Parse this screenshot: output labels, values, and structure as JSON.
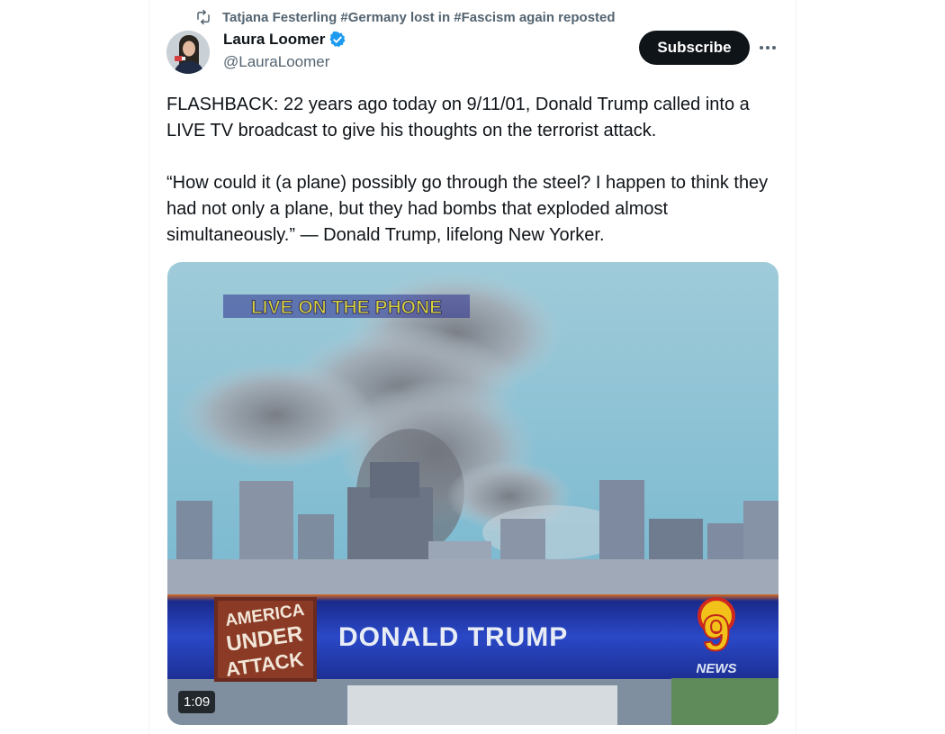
{
  "repost": {
    "icon": "repost-icon",
    "text": "Tatjana Festerling #Germany lost in #Fascism again reposted"
  },
  "author": {
    "name": "Laura Loomer",
    "handle": "@LauraLoomer",
    "verified_icon": "verified-badge-icon",
    "verified_color": "#1d9bf0"
  },
  "subscribe_label": "Subscribe",
  "more_icon": "more-options-icon",
  "tweet_text": "FLASHBACK: 22 years ago today on 9/11/01, Donald Trump called into a LIVE TV broadcast to give his thoughts on the terrorist attack.\n\n“How could it (a plane) possibly go through the steel? I happen to think they had not only a plane, but they had bombs that exploded almost simultaneously.” — Donald Trump, lifelong New Yorker.",
  "video": {
    "overlay_top": "LIVE ON THE PHONE",
    "chyron_name": "DONALD TRUMP",
    "chyron_logo_lines": [
      "AMERICA",
      "UNDER",
      "ATTACK"
    ],
    "station_number": "9",
    "station_label": "NEWS",
    "duration": "1:09"
  }
}
